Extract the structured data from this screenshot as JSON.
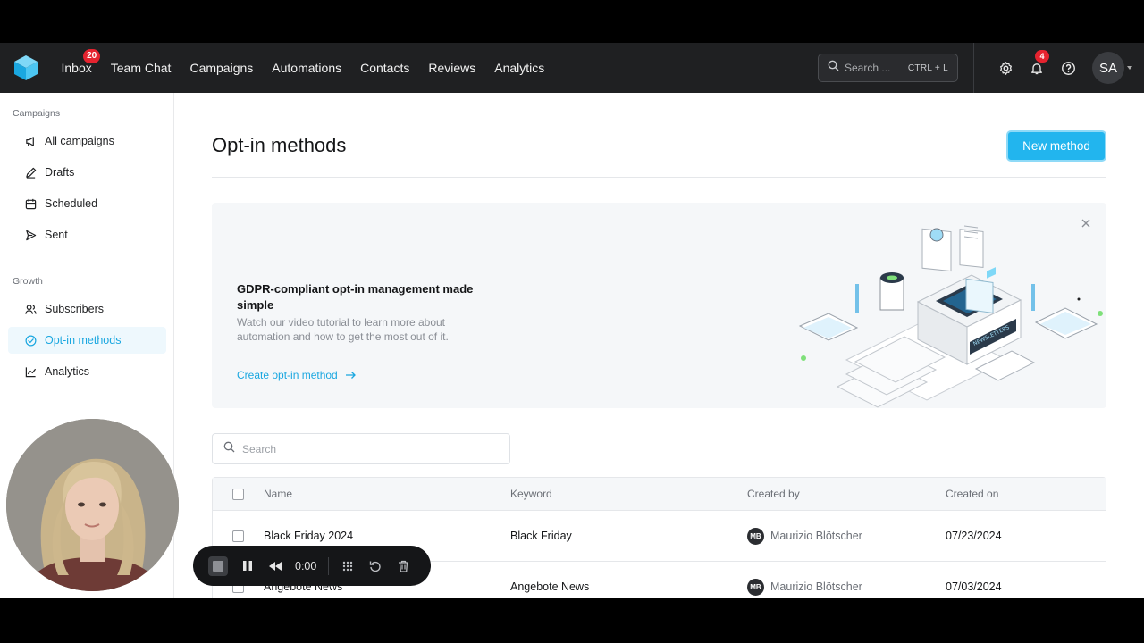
{
  "nav": {
    "items": [
      {
        "label": "Inbox",
        "badge": "20"
      },
      {
        "label": "Team Chat"
      },
      {
        "label": "Campaigns"
      },
      {
        "label": "Automations"
      },
      {
        "label": "Contacts"
      },
      {
        "label": "Reviews"
      },
      {
        "label": "Analytics"
      }
    ],
    "search_placeholder": "Search ...",
    "search_shortcut": "CTRL + L",
    "notifications_badge": "4",
    "avatar_initials": "SA"
  },
  "sidebar": {
    "sections": [
      {
        "title": "Campaigns",
        "items": [
          {
            "label": "All campaigns",
            "icon": "megaphone-icon"
          },
          {
            "label": "Drafts",
            "icon": "pencil-icon"
          },
          {
            "label": "Scheduled",
            "icon": "calendar-icon"
          },
          {
            "label": "Sent",
            "icon": "send-icon"
          }
        ]
      },
      {
        "title": "Growth",
        "items": [
          {
            "label": "Subscribers",
            "icon": "users-icon"
          },
          {
            "label": "Opt-in methods",
            "icon": "opt-in-icon",
            "active": true
          },
          {
            "label": "Analytics",
            "icon": "chart-line-icon"
          }
        ]
      }
    ]
  },
  "main": {
    "title": "Opt-in methods",
    "new_button": "New method",
    "banner": {
      "title": "GDPR-compliant opt-in management made simple",
      "description": "Watch our video tutorial to learn more about automation and how to get the most out of it.",
      "link": "Create opt-in method",
      "illustration_label": "NEWSLETTERS"
    },
    "search_placeholder": "Search",
    "table": {
      "columns": [
        "Name",
        "Keyword",
        "Created by",
        "Created on"
      ],
      "rows": [
        {
          "name": "Black Friday 2024",
          "keyword": "Black Friday",
          "creator_initials": "MB",
          "creator": "Maurizio Blötscher",
          "created_on": "07/23/2024"
        },
        {
          "name": "Angebote News",
          "keyword": "Angebote News",
          "creator_initials": "MB",
          "creator": "Maurizio Blötscher",
          "created_on": "07/03/2024"
        }
      ]
    }
  },
  "recorder": {
    "time": "0:00"
  },
  "colors": {
    "accent": "#22b5ee",
    "nav_bg": "#1f2022",
    "badge": "#e5232f"
  }
}
